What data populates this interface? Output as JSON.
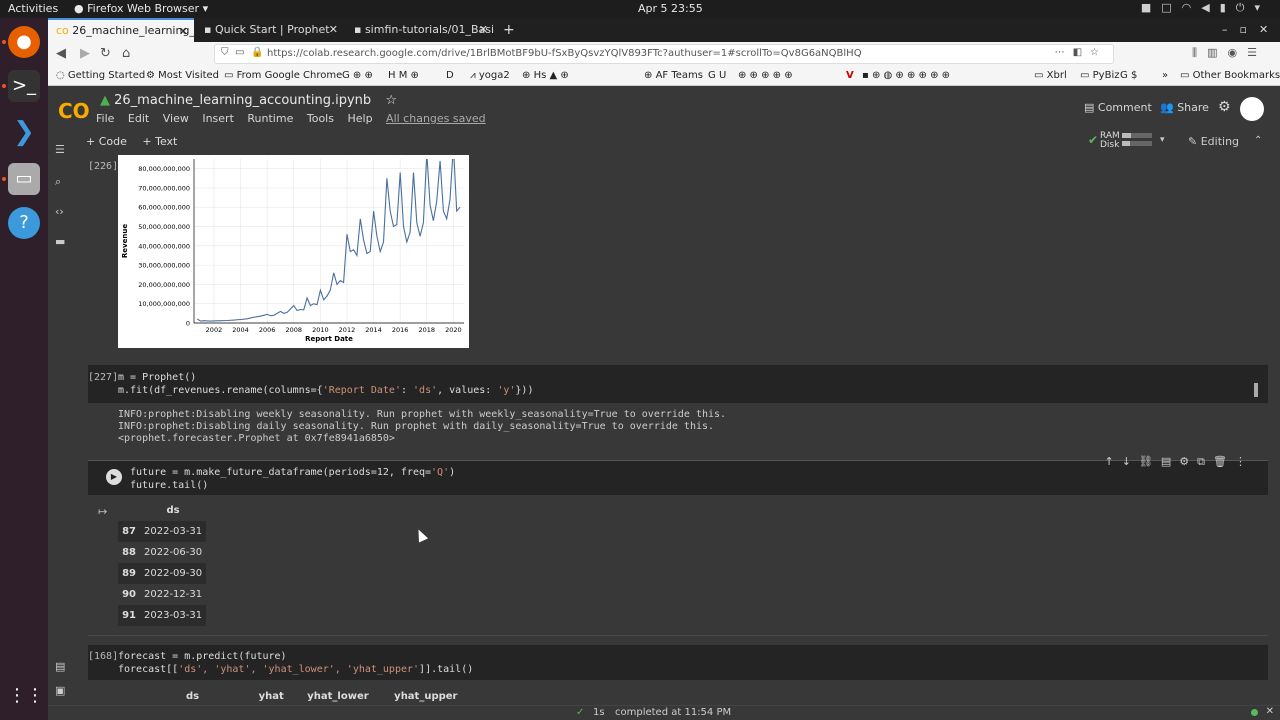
{
  "system": {
    "activities": "Activities",
    "app_name": "Firefox Web Browser",
    "clock": "Apr 5 23:55"
  },
  "tabs": [
    {
      "label": "26_machine_learning_ac"
    },
    {
      "label": "Quick Start | Prophet"
    },
    {
      "label": "simfin-tutorials/01_Basi"
    }
  ],
  "url": "https://colab.research.google.com/drive/1BrlBMotBF9bU-fSxByQsvzYQlV893FTc?authuser=1#scrollTo=Qv8G6aNQBlHQ",
  "bookmarks": [
    "Getting Started",
    "Most Visited",
    "From Google Chrome",
    "H",
    "D",
    "yoga2",
    "Hs",
    "AF Teams",
    "U",
    "V",
    "Xbrl",
    "PyBiz",
    "$",
    "Other Bookmarks"
  ],
  "colab": {
    "logo": "CO",
    "title": "26_machine_learning_accounting.ipynb",
    "menu": [
      "File",
      "Edit",
      "View",
      "Insert",
      "Runtime",
      "Tools",
      "Help"
    ],
    "saved": "All changes saved",
    "comment": "Comment",
    "share": "Share",
    "add_code": "+ Code",
    "add_text": "+ Text",
    "ram": "RAM",
    "disk": "Disk",
    "editing": "Editing",
    "ram_usage": 0.3,
    "disk_usage": 0.25
  },
  "cells": {
    "c226": {
      "count": "[226]"
    },
    "c227": {
      "count": "[227]",
      "line1": "m = Prophet()",
      "line2a": "m.fit(df_revenues.rename(columns={",
      "line2s1": "'Report Date'",
      "line2b": ": ",
      "line2s2": "'ds'",
      "line2c": ", values: ",
      "line2s3": "'y'",
      "line2d": "}))",
      "out1": "INFO:prophet:Disabling weekly seasonality. Run prophet with weekly_seasonality=True to override this.",
      "out2": "INFO:prophet:Disabling daily seasonality. Run prophet with daily_seasonality=True to override this.",
      "out3": "<prophet.forecaster.Prophet at 0x7fe8941a6850>"
    },
    "active": {
      "line1a": "future = m.make_future_dataframe(periods=12, freq=",
      "line1s": "'Q'",
      "line1b": ")",
      "line2": "future.tail()",
      "table_header": "ds",
      "rows": [
        {
          "idx": "87",
          "ds": "2022-03-31"
        },
        {
          "idx": "88",
          "ds": "2022-06-30"
        },
        {
          "idx": "89",
          "ds": "2022-09-30"
        },
        {
          "idx": "90",
          "ds": "2022-12-31"
        },
        {
          "idx": "91",
          "ds": "2023-03-31"
        }
      ]
    },
    "c168": {
      "count": "[168]",
      "line1": "forecast = m.predict(future)",
      "line2a": "forecast[[",
      "line2s": "'ds', 'yhat', 'yhat_lower', 'yhat_upper'",
      "line2b": "]].tail()",
      "headers": [
        "ds",
        "yhat",
        "yhat_lower",
        "yhat_upper"
      ]
    }
  },
  "status": {
    "duration": "1s",
    "completed": "completed at 11:54 PM"
  },
  "chart_data": {
    "type": "line",
    "xlabel": "Report Date",
    "ylabel": "Revenue",
    "xlim": [
      2000.5,
      2020.8
    ],
    "ylim": [
      0,
      85000000000
    ],
    "xticks": [
      "2002",
      "2004",
      "2006",
      "2008",
      "2010",
      "2012",
      "2014",
      "2016",
      "2018",
      "2020"
    ],
    "yticks": [
      "0",
      "10,000,000,000",
      "20,000,000,000",
      "30,000,000,000",
      "40,000,000,000",
      "50,000,000,000",
      "60,000,000,000",
      "70,000,000,000",
      "80,000,000,000"
    ],
    "series": [
      {
        "color": "#4a6f9e",
        "x": [
          2000.75,
          2001.0,
          2001.25,
          2001.5,
          2001.75,
          2002.0,
          2002.5,
          2003.0,
          2003.5,
          2004.0,
          2004.5,
          2005.0,
          2005.5,
          2006.0,
          2006.25,
          2006.5,
          2007.0,
          2007.25,
          2007.5,
          2008.0,
          2008.25,
          2008.5,
          2008.75,
          2009.0,
          2009.25,
          2009.5,
          2009.75,
          2010.0,
          2010.25,
          2010.5,
          2010.75,
          2011.0,
          2011.25,
          2011.5,
          2011.75,
          2012.0,
          2012.25,
          2012.5,
          2012.75,
          2013.0,
          2013.25,
          2013.5,
          2013.75,
          2014.0,
          2014.25,
          2014.5,
          2014.75,
          2015.0,
          2015.25,
          2015.5,
          2015.75,
          2016.0,
          2016.25,
          2016.5,
          2016.75,
          2017.0,
          2017.25,
          2017.5,
          2017.75,
          2018.0,
          2018.25,
          2018.5,
          2018.75,
          2019.0,
          2019.25,
          2019.5,
          2019.75,
          2020.0,
          2020.25,
          2020.5
        ],
        "y": [
          2000000000,
          1000000000,
          1200000000,
          1100000000,
          1000000000,
          1100000000,
          1200000000,
          1300000000,
          1500000000,
          1800000000,
          2200000000,
          3000000000,
          3500000000,
          4500000000,
          3800000000,
          4000000000,
          6000000000,
          5000000000,
          5500000000,
          9000000000,
          6500000000,
          7000000000,
          6800000000,
          13000000000,
          9000000000,
          10000000000,
          9500000000,
          17000000000,
          12000000000,
          14000000000,
          17000000000,
          26000000000,
          20000000000,
          22000000000,
          21000000000,
          46000000000,
          37000000000,
          38000000000,
          35000000000,
          54000000000,
          43000000000,
          36000000000,
          37000000000,
          58000000000,
          45000000000,
          37000000000,
          42000000000,
          75000000000,
          58000000000,
          50000000000,
          51000000000,
          78000000000,
          50000000000,
          42000000000,
          47000000000,
          78000000000,
          52000000000,
          45000000000,
          52000000000,
          88000000000,
          61000000000,
          53000000000,
          63000000000,
          84000000000,
          58000000000,
          54000000000,
          64000000000,
          92000000000,
          58000000000,
          60000000000
        ]
      }
    ]
  }
}
